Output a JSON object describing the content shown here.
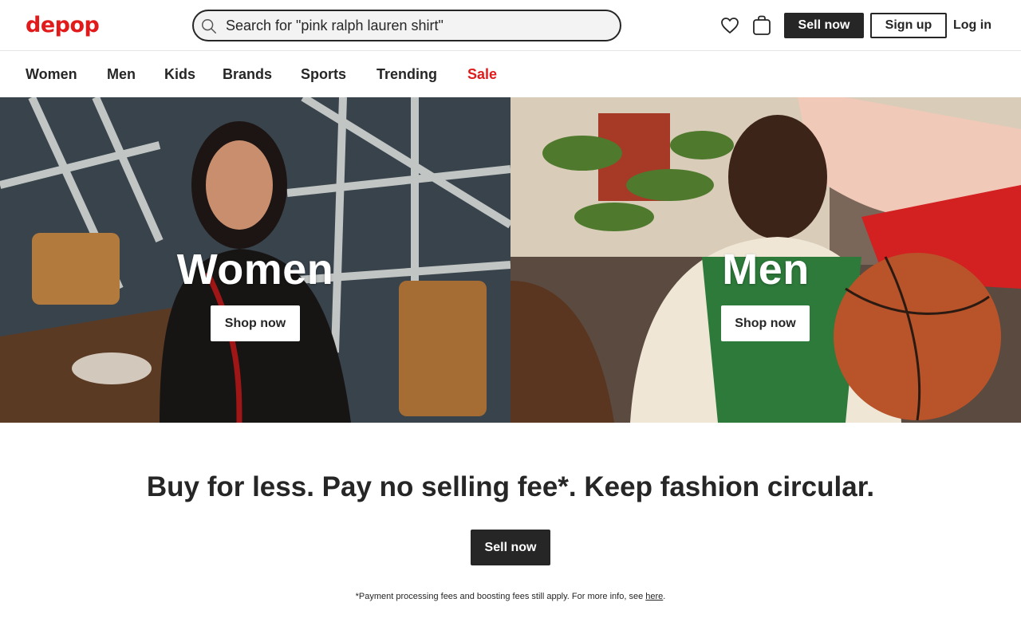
{
  "brand": {
    "logo": "depop",
    "accent_color": "#e11b1b",
    "dark_color": "#262626"
  },
  "header": {
    "search_placeholder": "Search for \"pink ralph lauren shirt\"",
    "icons": [
      "search-icon",
      "heart-icon",
      "bag-icon"
    ],
    "sell_label": "Sell now",
    "signup_label": "Sign up",
    "login_label": "Log in"
  },
  "nav": {
    "items": [
      {
        "label": "Women"
      },
      {
        "label": "Men"
      },
      {
        "label": "Kids"
      },
      {
        "label": "Brands"
      },
      {
        "label": "Sports"
      },
      {
        "label": "Trending"
      },
      {
        "label": "Sale",
        "color": "#e11b1b"
      }
    ]
  },
  "hero": {
    "panels": [
      {
        "title": "Women",
        "button": "Shop now"
      },
      {
        "title": "Men",
        "button": "Shop now"
      }
    ]
  },
  "promo": {
    "headline": "Buy for less. Pay no selling fee*. Keep fashion circular.",
    "sell_label": "Sell now",
    "fine_print": "*Payment processing fees and boosting fees still apply. For more info, see ",
    "fine_link": "here",
    "fine_end": "."
  }
}
